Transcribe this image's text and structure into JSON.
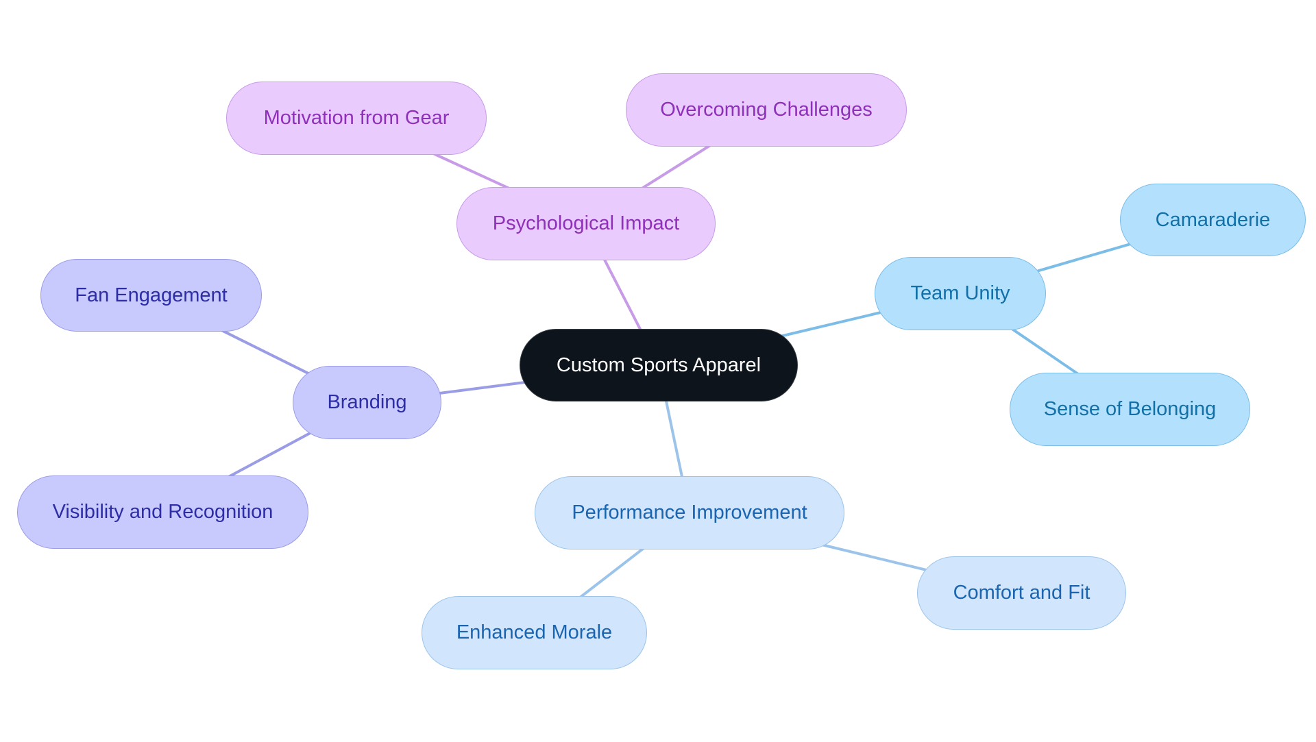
{
  "title": "Custom Sports Apparel mind map",
  "colors": {
    "root_fill": "#0d141b",
    "root_text": "#ffffff",
    "purple_fill": "#eacbfd",
    "purple_border": "#c79be8",
    "purple_text": "#8e30b8",
    "purple_edge": "#c79be8",
    "blue_fill": "#b3e0fc",
    "blue_border": "#7cbde8",
    "blue_text": "#1270a8",
    "blue_edge": "#7cbde8",
    "indigo_fill": "#c8c9fc",
    "indigo_border": "#9a9ce6",
    "indigo_text": "#2d2da6",
    "indigo_edge": "#9a9ce6",
    "lightblue_fill": "#d1e5fc",
    "lightblue_border": "#9cc4ea",
    "lightblue_text": "#1a64b0",
    "lightblue_edge": "#9cc4ea"
  },
  "root": {
    "id": "root",
    "label": "Custom Sports Apparel"
  },
  "nodes": [
    {
      "id": "psych",
      "label": "Psychological Impact",
      "parent": "root",
      "theme": "purple"
    },
    {
      "id": "motivation",
      "label": "Motivation from Gear",
      "parent": "psych",
      "theme": "purple"
    },
    {
      "id": "overcoming",
      "label": "Overcoming Challenges",
      "parent": "psych",
      "theme": "purple"
    },
    {
      "id": "team",
      "label": "Team Unity",
      "parent": "root",
      "theme": "blue"
    },
    {
      "id": "camaraderie",
      "label": "Camaraderie",
      "parent": "team",
      "theme": "blue"
    },
    {
      "id": "belonging",
      "label": "Sense of Belonging",
      "parent": "team",
      "theme": "blue"
    },
    {
      "id": "branding",
      "label": "Branding",
      "parent": "root",
      "theme": "indigo"
    },
    {
      "id": "fan",
      "label": "Fan Engagement",
      "parent": "branding",
      "theme": "indigo"
    },
    {
      "id": "visibility",
      "label": "Visibility and Recognition",
      "parent": "branding",
      "theme": "indigo"
    },
    {
      "id": "performance",
      "label": "Performance Improvement",
      "parent": "root",
      "theme": "lightblue"
    },
    {
      "id": "morale",
      "label": "Enhanced Morale",
      "parent": "performance",
      "theme": "lightblue"
    },
    {
      "id": "comfort",
      "label": "Comfort and Fit",
      "parent": "performance",
      "theme": "lightblue"
    }
  ]
}
